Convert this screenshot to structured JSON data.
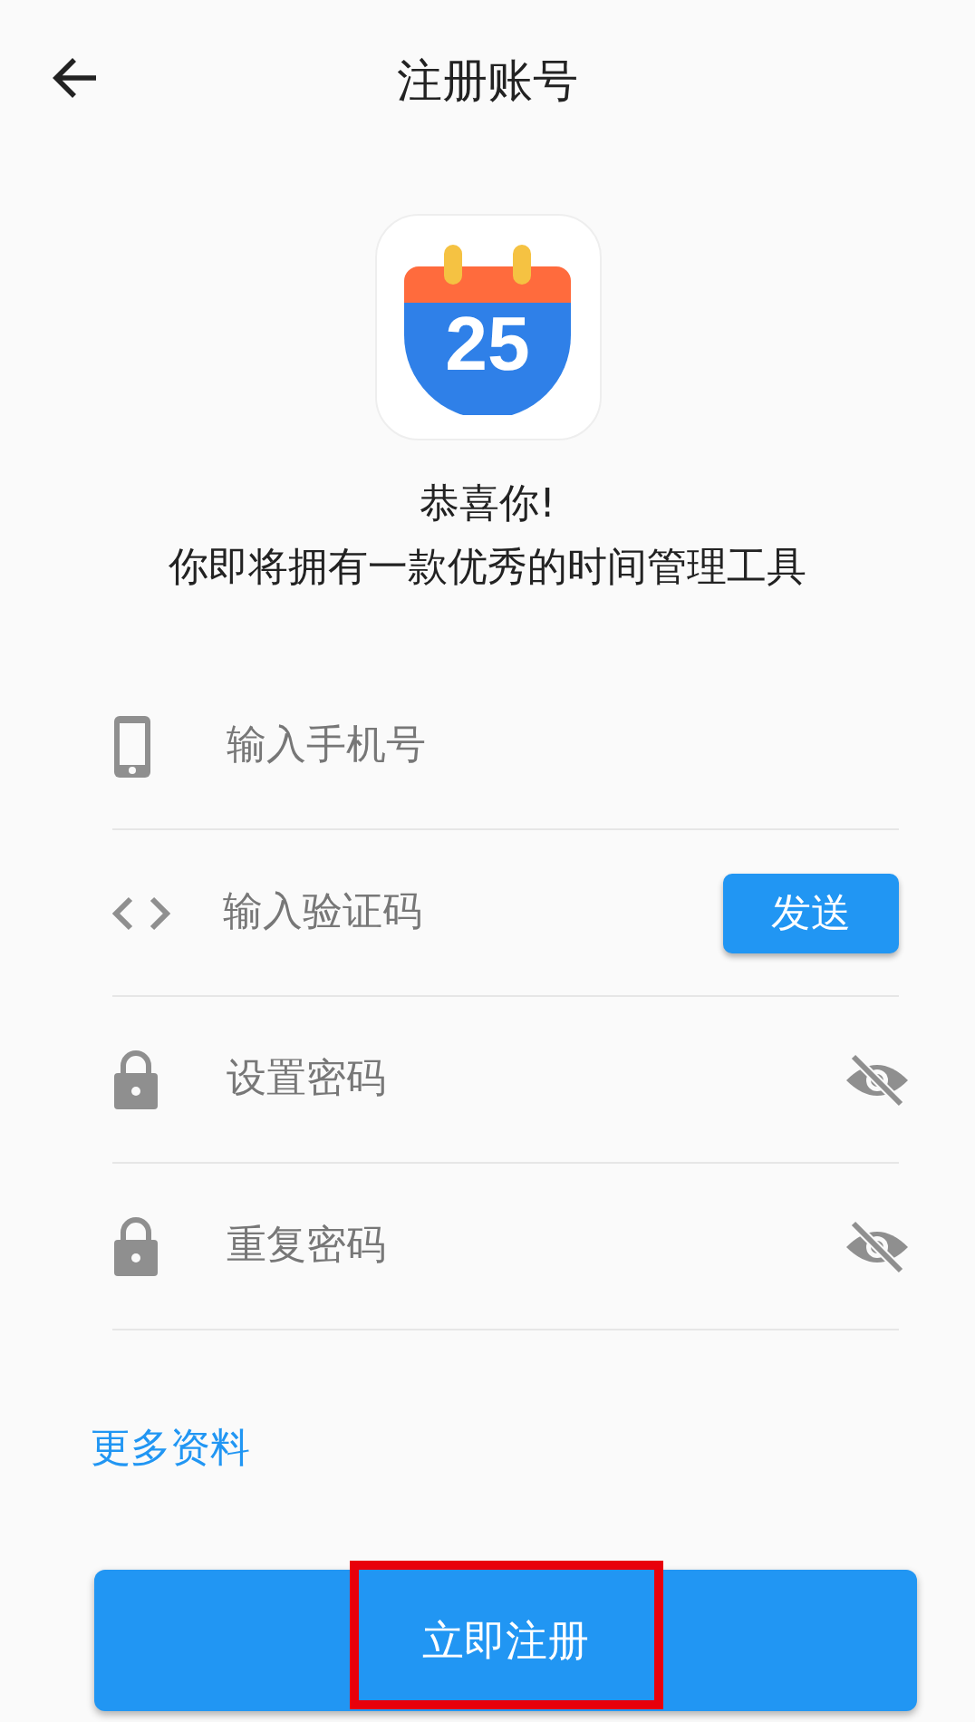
{
  "header": {
    "title": "注册账号"
  },
  "logo": {
    "day": "25"
  },
  "greeting": {
    "line1": "恭喜你!",
    "line2": "你即将拥有一款优秀的时间管理工具"
  },
  "fields": [
    {
      "kind": "phone",
      "placeholder": "输入手机号"
    },
    {
      "kind": "code",
      "placeholder": "输入验证码",
      "action": "发送"
    },
    {
      "kind": "password",
      "placeholder": "设置密码",
      "visible": false
    },
    {
      "kind": "password",
      "placeholder": "重复密码",
      "visible": false
    }
  ],
  "more_link": "更多资料",
  "submit": {
    "label": "立即注册",
    "highlighted": true
  }
}
